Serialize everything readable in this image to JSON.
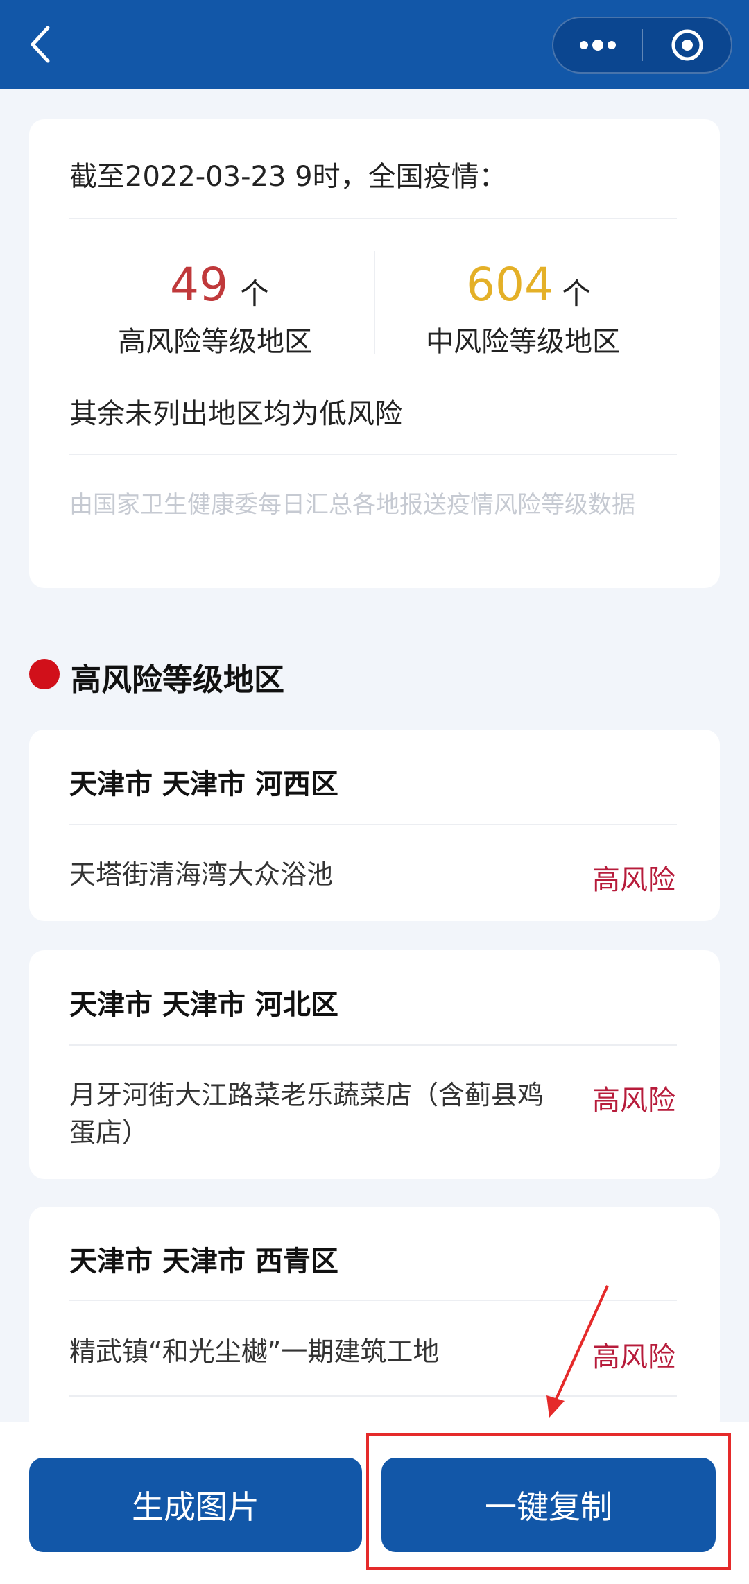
{
  "summary": {
    "title": "截至2022-03-23 9时，全国疫情：",
    "high_count": "49",
    "high_unit": "个",
    "high_label": "高风险等级地区",
    "mid_count": "604",
    "mid_unit": "个",
    "mid_label": "中风险等级地区",
    "low_note": "其余未列出地区均为低风险",
    "source_note": "由国家卫生健康委每日汇总各地报送疫情风险等级数据"
  },
  "section": {
    "title": "高风险等级地区"
  },
  "regions": [
    {
      "title": "天津市 天津市 河西区",
      "place": "天塔街清海湾大众浴池",
      "risk": "高风险"
    },
    {
      "title": "天津市 天津市 河北区",
      "place": "月牙河街大江路菜老乐蔬菜店（含蓟县鸡蛋店）",
      "risk": "高风险"
    },
    {
      "title": "天津市 天津市 西青区",
      "place": "精武镇“和光尘樾”一期建筑工地",
      "risk": "高风险"
    }
  ],
  "buttons": {
    "generate_image": "生成图片",
    "copy_all": "一键复制"
  },
  "icons": {
    "back": "chevron-left-icon",
    "more": "more-dots-icon",
    "close": "target-icon"
  },
  "colors": {
    "nav_bg": "#1257a8",
    "high_count": "#c0393b",
    "mid_count": "#e4b027",
    "risk_text": "#b71c3b",
    "section_dot": "#d1101a",
    "annotation": "#e52a2a"
  }
}
